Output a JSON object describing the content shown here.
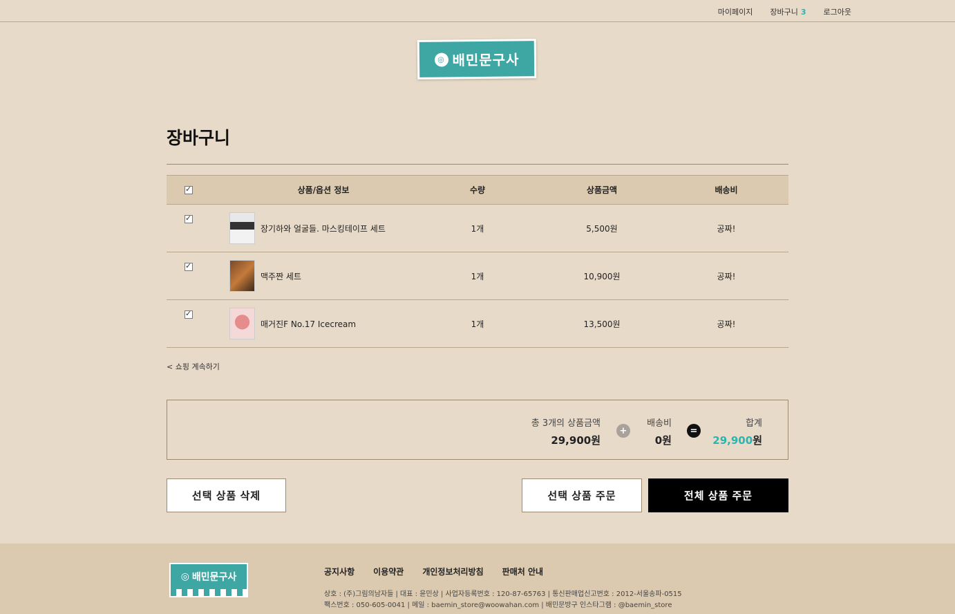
{
  "topnav": {
    "mypage": "마이페이지",
    "cart": "장바구니",
    "cart_count": "3",
    "logout": "로그아웃"
  },
  "brand": {
    "name": "배민문구사"
  },
  "page": {
    "title": "장바구니"
  },
  "table": {
    "headers": {
      "info": "상품/옵션 정보",
      "qty": "수량",
      "price": "상품금액",
      "ship": "배송비"
    },
    "rows": [
      {
        "name": "장기하와 얼굴들. 마스킹테이프 세트",
        "qty": "1개",
        "price": "5,500원",
        "ship": "공짜!"
      },
      {
        "name": "맥주짠 세트",
        "qty": "1개",
        "price": "10,900원",
        "ship": "공짜!"
      },
      {
        "name": "매거진F No.17 Icecream",
        "qty": "1개",
        "price": "13,500원",
        "ship": "공짜!"
      }
    ]
  },
  "continue_link": "< 쇼핑 계속하기",
  "summary": {
    "items_label": "총 3개의 상품금액",
    "items_value": "29,900원",
    "plus": "+",
    "ship_label": "배송비",
    "ship_value": "0원",
    "equals": "=",
    "total_label": "합계",
    "total_number": "29,900",
    "total_unit": "원"
  },
  "buttons": {
    "delete_selected": "선택 상품 삭제",
    "order_selected": "선택 상품 주문",
    "order_all": "전체 상품 주문"
  },
  "footer": {
    "links": [
      "공지사항",
      "이용약관",
      "개인정보처리방침",
      "판매처 안내"
    ],
    "info_line1": "상호 : (주)그림의남자들 | 대표 : 윤민상 | 사업자등록번호 : 120-87-65763 | 통신판매업신고번호 : 2012-서울송파-0515",
    "info_line2": "팩스번호 : 050-605-0041 | 메일 : baemin_store@woowahan.com | 배민문방구 인스타그램 : @baemin_store"
  },
  "colors": {
    "background": "#e8dac8",
    "accent": "#2bb5b0",
    "header_row": "#dccab0"
  }
}
